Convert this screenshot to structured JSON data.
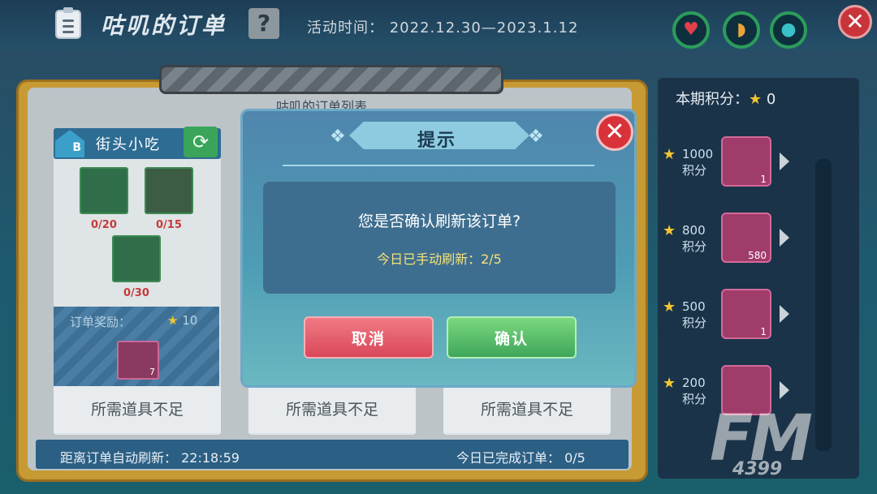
{
  "header": {
    "title": "咕叽的订单",
    "help_icon": "?",
    "activity": "活动时间：  2022.12.30—2023.1.12"
  },
  "resources": [
    {
      "icon": "heart-icon",
      "glyph": "♥",
      "color": "#e0404a"
    },
    {
      "icon": "bread-icon",
      "glyph": "◗",
      "color": "#e8a43a"
    },
    {
      "icon": "water-drop-icon",
      "glyph": "●",
      "color": "#3ac0c8"
    }
  ],
  "board": {
    "list_title": "咕叽的订单列表",
    "card": {
      "name": "街头小吃",
      "tier": "B",
      "items": [
        {
          "count": "0/20"
        },
        {
          "count": "0/15"
        },
        {
          "count": "0/30"
        }
      ],
      "reward_label": "订单奖励：",
      "reward_value": "10",
      "reward_item_count": "7"
    },
    "need_text": [
      "所需道具不足",
      "所需道具不足",
      "所需道具不足"
    ],
    "refresh_label": "距离订单自动刷新：",
    "refresh_time": "22:18:59",
    "done_label": "今日已完成订单：",
    "done_value": "0/5"
  },
  "side": {
    "title": "本期积分：",
    "score": "0",
    "rewards": [
      {
        "pts": "1000",
        "unit": "积分",
        "count": "1"
      },
      {
        "pts": "800",
        "unit": "积分",
        "count": "580"
      },
      {
        "pts": "500",
        "unit": "积分",
        "count": "1"
      },
      {
        "pts": "200",
        "unit": "积分",
        "count": ""
      }
    ]
  },
  "dialog": {
    "title": "提示",
    "message": "您是否确认刷新该订单?",
    "sub_message": "今日已手动刷新：2/5",
    "cancel": "取消",
    "confirm": "确认",
    "close": "✕"
  },
  "watermark": {
    "main": "FM",
    "sub": "4399"
  }
}
